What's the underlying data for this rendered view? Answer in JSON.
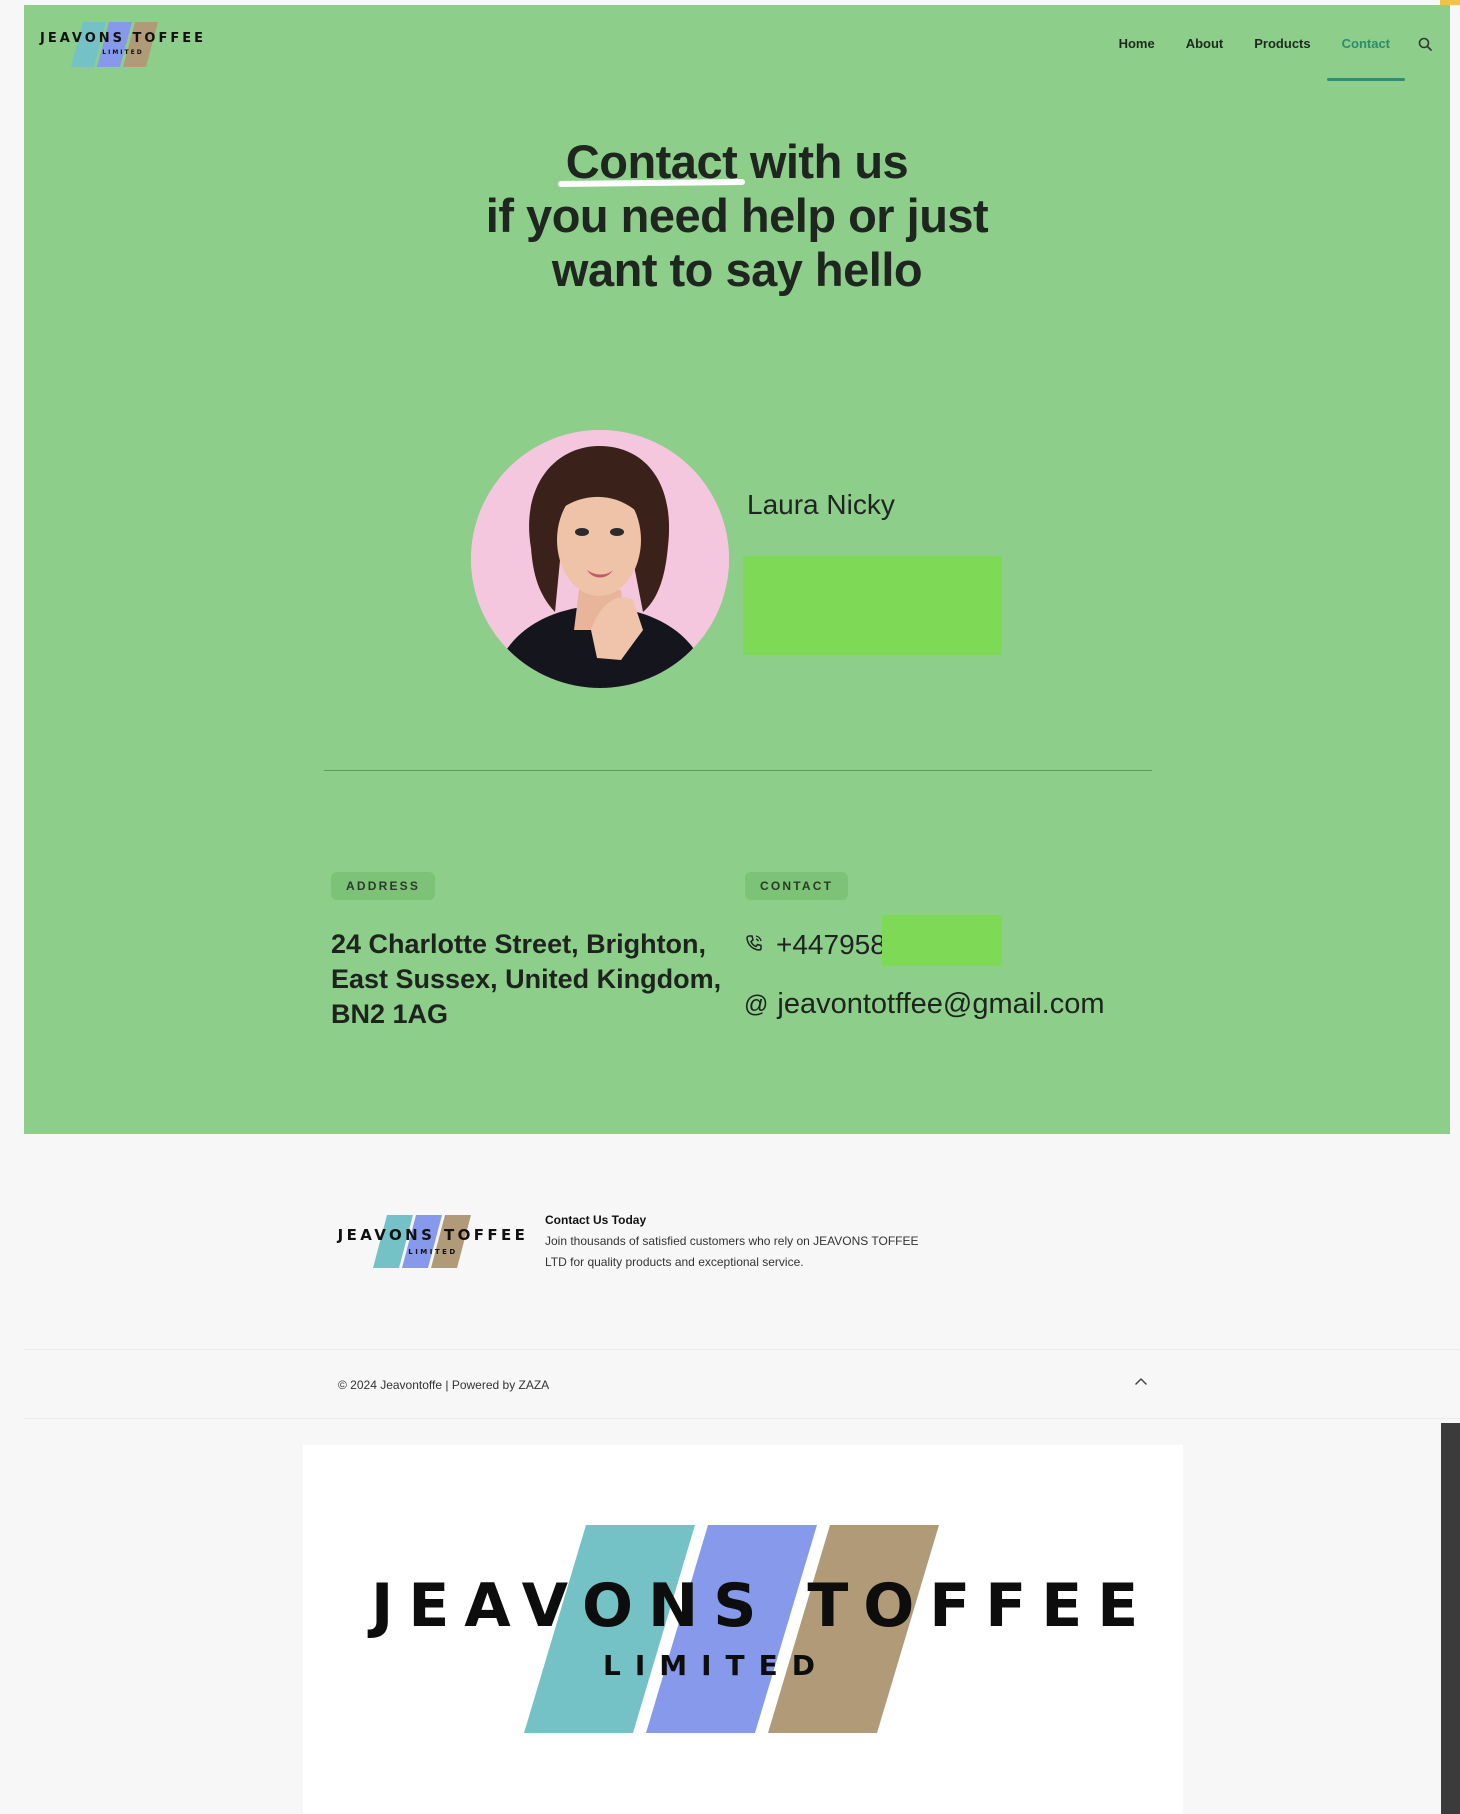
{
  "brand": {
    "name": "JEAVONS TOFFEE",
    "sub": "LIMITED",
    "colors": {
      "teal": "#74c2c6",
      "blue": "#8699eb",
      "tan": "#b19a78"
    }
  },
  "nav": {
    "items": [
      {
        "label": "Home",
        "active": false
      },
      {
        "label": "About",
        "active": false
      },
      {
        "label": "Products",
        "active": false
      },
      {
        "label": "Contact",
        "active": true
      }
    ],
    "search_icon": "search-icon"
  },
  "hero": {
    "headline_word1": "Contact",
    "headline_rest1": "with us",
    "headline_line2": "if you need help or just",
    "headline_line3": "want to say hello",
    "person_name": "Laura Nicky"
  },
  "address": {
    "tag": "ADDRESS",
    "text": "24 Charlotte Street, Brighton, East Sussex, United Kingdom, BN2 1AG"
  },
  "contact": {
    "tag": "CONTACT",
    "phone": "+447958",
    "phone_icon": "phone-icon",
    "email_symbol": "@",
    "email": "jeavontotffee@gmail.com"
  },
  "footer": {
    "title": "Contact Us Today",
    "description": "Join thousands of satisfied customers who rely on JEAVONS TOFFEE LTD for quality products and exceptional service.",
    "copyright": "© 2024 Jeavontoffe | Powered by ZAZA",
    "scroll_icon": "chevron-up-icon"
  },
  "colors": {
    "hero_bg": "#8dce8b",
    "tag_bg": "#7cc378",
    "redaction": "#7ed957",
    "nav_active": "#2d8c6d"
  }
}
